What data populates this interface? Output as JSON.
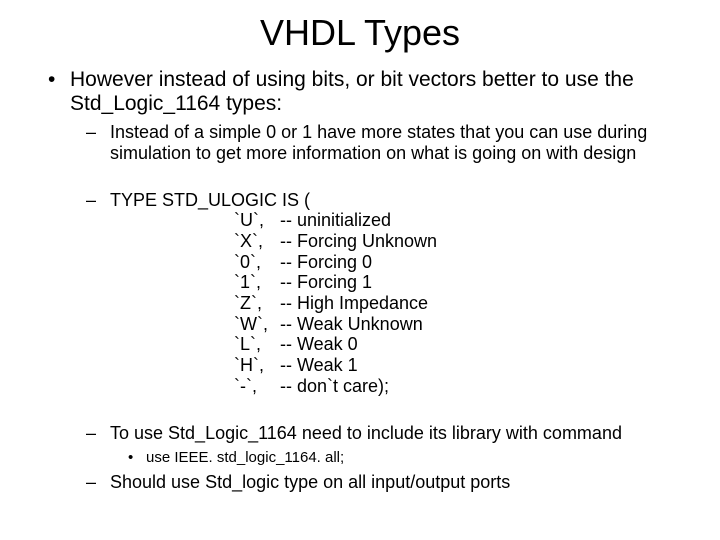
{
  "title": "VHDL Types",
  "intro": "However instead of using bits, or bit vectors better to use the Std_Logic_1164 types:",
  "sub1": "Instead of a simple 0 or 1 have more states that you can use during simulation to get more information on what is going on with design",
  "type_head": "TYPE   STD_ULOGIC  IS (",
  "enum": [
    {
      "sym": "`U`,",
      "com": "-- uninitialized"
    },
    {
      "sym": "`X`,",
      "com": "-- Forcing  Unknown"
    },
    {
      "sym": "`0`,",
      "com": "-- Forcing  0"
    },
    {
      "sym": "`1`,",
      "com": "-- Forcing  1"
    },
    {
      "sym": "`Z`,",
      "com": "-- High Impedance"
    },
    {
      "sym": "`W`,",
      "com": "-- Weak Unknown"
    },
    {
      "sym": "`L`,",
      "com": "-- Weak 0"
    },
    {
      "sym": "`H`,",
      "com": "-- Weak 1"
    },
    {
      "sym": "`-`,",
      "com": "-- don`t care);"
    }
  ],
  "sub3": "To use Std_Logic_1164 need to include its library with command",
  "sub3a": "use IEEE. std_logic_1164. all;",
  "sub4": "Should use Std_logic type on all input/output ports"
}
